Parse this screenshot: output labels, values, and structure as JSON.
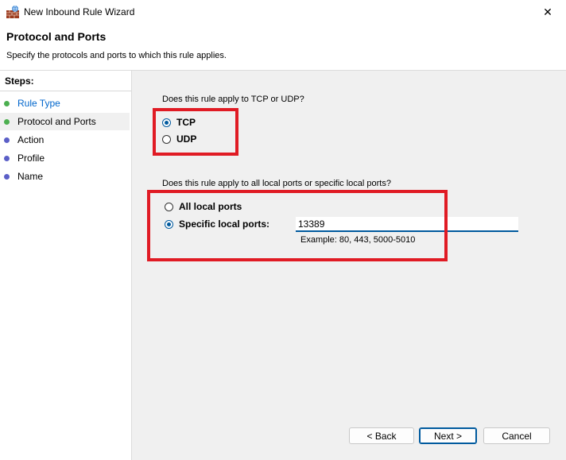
{
  "window": {
    "title": "New Inbound Rule Wizard",
    "close_glyph": "✕"
  },
  "header": {
    "title": "Protocol and Ports",
    "description": "Specify the protocols and ports to which this rule applies."
  },
  "steps": {
    "title": "Steps:",
    "items": [
      {
        "label": "Rule Type",
        "dot_color": "#4caf50"
      },
      {
        "label": "Protocol and Ports",
        "dot_color": "#4caf50"
      },
      {
        "label": "Action",
        "dot_color": "#5b5fc7"
      },
      {
        "label": "Profile",
        "dot_color": "#5b5fc7"
      },
      {
        "label": "Name",
        "dot_color": "#5b5fc7"
      }
    ]
  },
  "protocol": {
    "question": "Does this rule apply to TCP or UDP?",
    "options": [
      {
        "label": "TCP",
        "selected": true
      },
      {
        "label": "UDP",
        "selected": false
      }
    ]
  },
  "ports": {
    "question": "Does this rule apply to all local ports or specific local ports?",
    "options": [
      {
        "label": "All local ports",
        "selected": false
      },
      {
        "label": "Specific local ports:",
        "selected": true
      }
    ],
    "input_value": "13389",
    "example": "Example: 80, 443, 5000-5010"
  },
  "buttons": {
    "back": "< Back",
    "next": "Next >",
    "cancel": "Cancel"
  },
  "colors": {
    "accent": "#005a9e",
    "highlight": "#e01b24"
  }
}
